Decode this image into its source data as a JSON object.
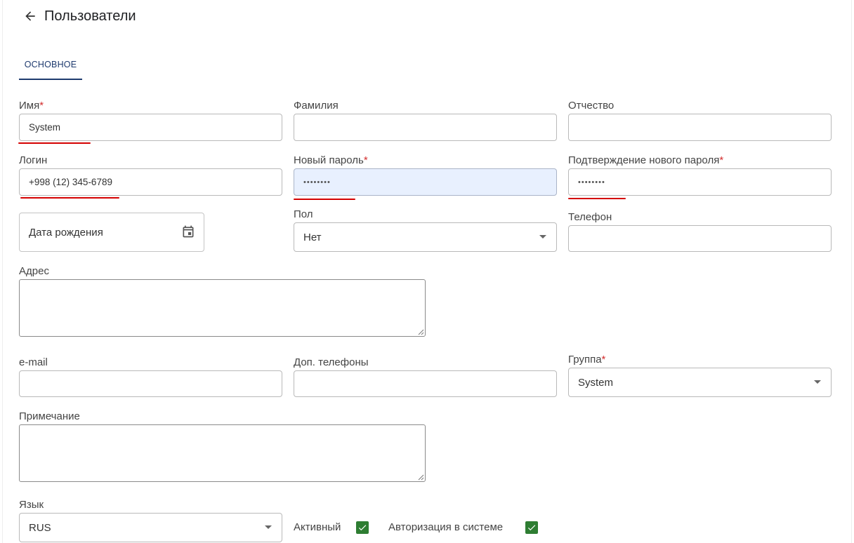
{
  "header": {
    "title": "Пользователи"
  },
  "tabs": [
    {
      "label": "ОСНОВНОЕ"
    }
  ],
  "form": {
    "first_name": {
      "label": "Имя",
      "required": "*",
      "value": "System"
    },
    "last_name": {
      "label": "Фамилия",
      "value": ""
    },
    "middle_name": {
      "label": "Отчество",
      "value": ""
    },
    "login": {
      "label": "Логин",
      "value": "+998 (12) 345-6789"
    },
    "new_password": {
      "label": "Новый пароль",
      "required": "*",
      "value": "••••••••"
    },
    "confirm_password": {
      "label": "Подтверждение нового пароля",
      "required": "*",
      "value": "••••••••"
    },
    "birth_date": {
      "placeholder": "Дата рождения"
    },
    "gender": {
      "label": "Пол",
      "value": "Нет"
    },
    "phone": {
      "label": "Телефон",
      "value": ""
    },
    "address": {
      "label": "Адрес"
    },
    "email": {
      "label": "e-mail",
      "value": ""
    },
    "extra_phones": {
      "label": "Доп. телефоны",
      "value": ""
    },
    "group": {
      "label": "Группа",
      "required": "*",
      "value": "System"
    },
    "note": {
      "label": "Примечание"
    },
    "language": {
      "label": "Язык",
      "value": "RUS"
    },
    "active": {
      "label": "Активный",
      "checked": true
    },
    "authorization": {
      "label": "Авторизация в системе",
      "checked": true
    }
  },
  "colors": {
    "accent": "#1e3a6e",
    "required": "#d32f2f",
    "annotation_underline": "#d40000",
    "checkbox": "#2e7d32",
    "autofill_bg": "#e8f0fe"
  }
}
